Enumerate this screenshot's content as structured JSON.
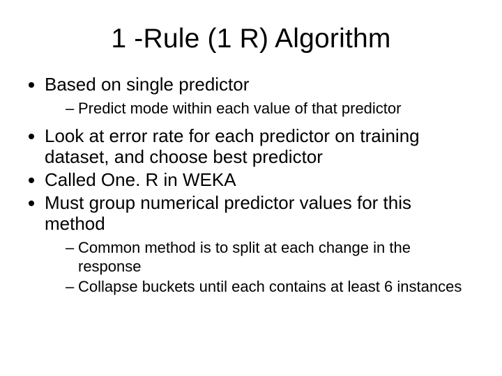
{
  "title": "1 -Rule (1 R) Algorithm",
  "bullets": {
    "b1": "Based on single predictor",
    "b1_sub1": "Predict mode within each value of that predictor",
    "b2": "Look at error rate for each predictor on training dataset, and choose best predictor",
    "b3": "Called One. R in WEKA",
    "b4": "Must group numerical predictor values for this method",
    "b4_sub1": "Common method is to split at each change in the response",
    "b4_sub2": "Collapse buckets until each contains at least 6 instances"
  }
}
